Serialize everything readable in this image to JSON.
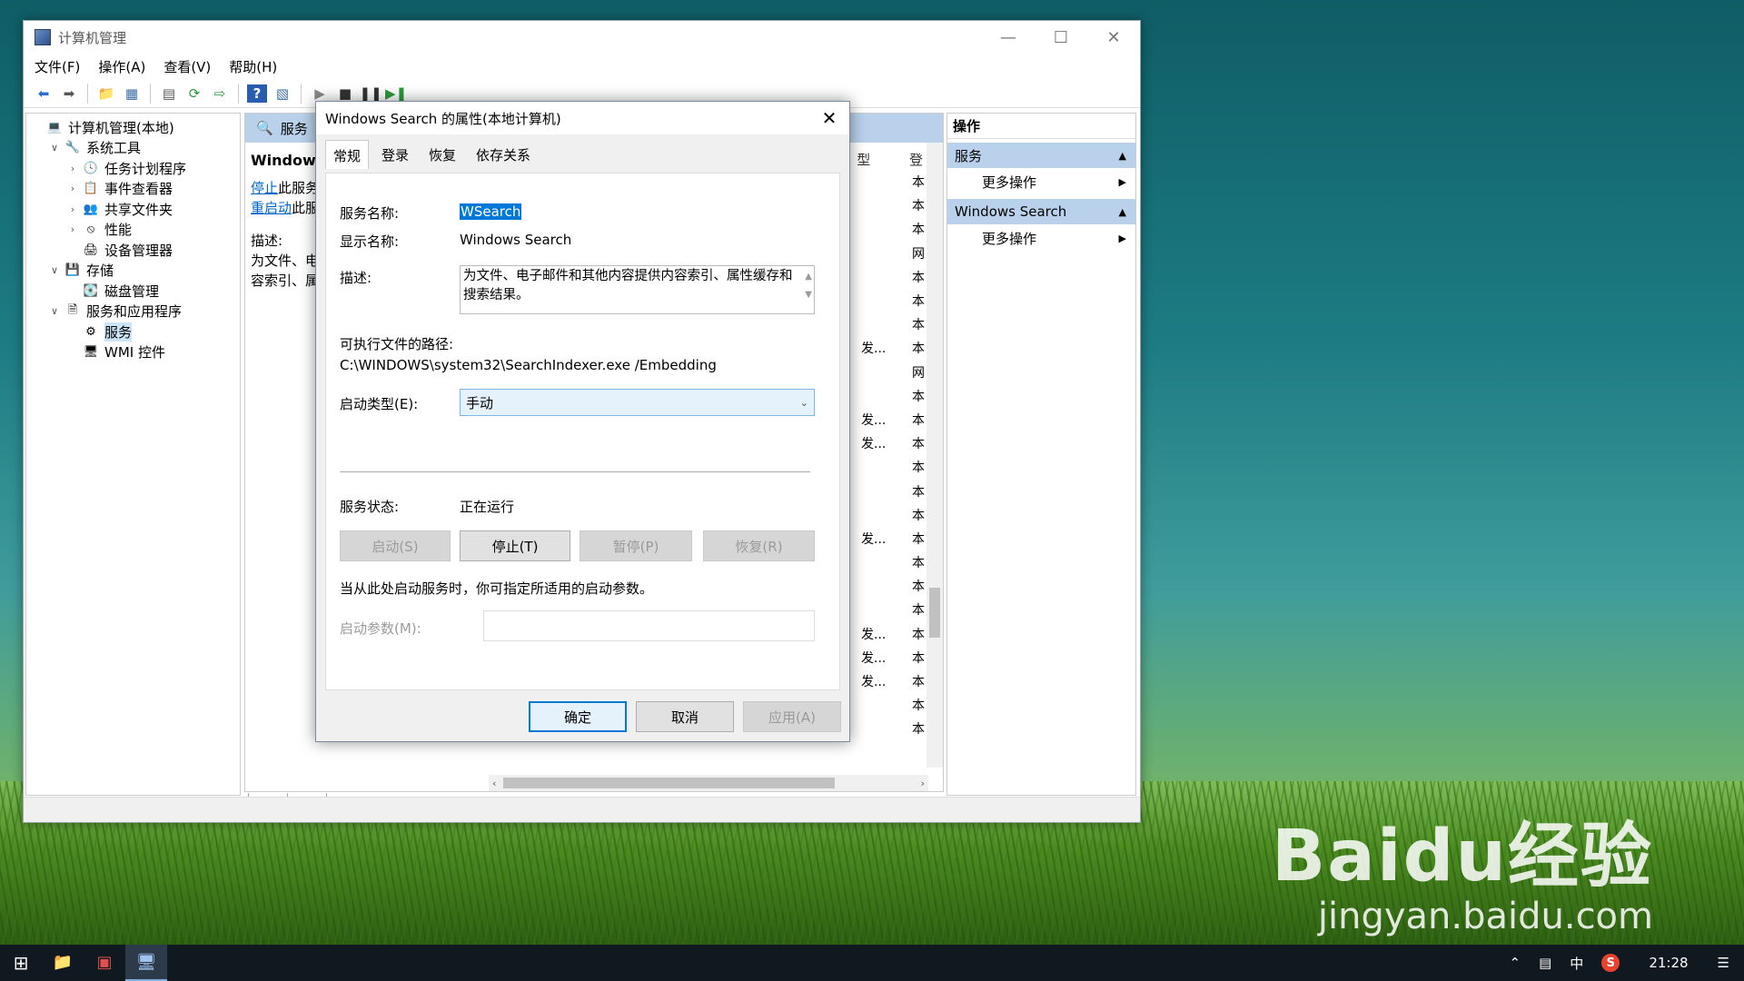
{
  "window": {
    "title": "计算机管理",
    "menu": [
      "文件(F)",
      "操作(A)",
      "查看(V)",
      "帮助(H)"
    ]
  },
  "tree": [
    {
      "label": "计算机管理(本地)",
      "icon": "computer-icon",
      "indent": 0,
      "expander": ""
    },
    {
      "label": "系统工具",
      "icon": "tools-icon",
      "indent": 1,
      "expander": "∨"
    },
    {
      "label": "任务计划程序",
      "icon": "clock-icon",
      "indent": 2,
      "expander": "›"
    },
    {
      "label": "事件查看器",
      "icon": "event-icon",
      "indent": 2,
      "expander": "›"
    },
    {
      "label": "共享文件夹",
      "icon": "share-icon",
      "indent": 2,
      "expander": "›"
    },
    {
      "label": "性能",
      "icon": "performance-icon",
      "indent": 2,
      "expander": "›"
    },
    {
      "label": "设备管理器",
      "icon": "device-icon",
      "indent": 2,
      "expander": ""
    },
    {
      "label": "存储",
      "icon": "storage-icon",
      "indent": 1,
      "expander": "∨"
    },
    {
      "label": "磁盘管理",
      "icon": "disk-icon",
      "indent": 2,
      "expander": ""
    },
    {
      "label": "服务和应用程序",
      "icon": "services-apps-icon",
      "indent": 1,
      "expander": "∨"
    },
    {
      "label": "服务",
      "icon": "services-icon",
      "indent": 2,
      "expander": "",
      "selected": true
    },
    {
      "label": "WMI 控件",
      "icon": "wmi-icon",
      "indent": 2,
      "expander": ""
    }
  ],
  "center": {
    "header": "服务",
    "service_name": "Windows",
    "stop_link": "停止",
    "stop_rest": "此服务",
    "restart_link": "重启动",
    "restart_rest": "此服",
    "desc_label": "描述:",
    "desc_line1": "为文件、电",
    "desc_line2": "容索引、属",
    "col_header_1": "型",
    "col_header_2": "登",
    "col_rows": [
      [
        "",
        "本"
      ],
      [
        "",
        "本"
      ],
      [
        "",
        "本"
      ],
      [
        "",
        "网"
      ],
      [
        "",
        "本"
      ],
      [
        "",
        "本"
      ],
      [
        "",
        "本"
      ],
      [
        "发...",
        "本"
      ],
      [
        "",
        "网"
      ],
      [
        "",
        "本"
      ],
      [
        "发...",
        "本"
      ],
      [
        "发...",
        "本"
      ],
      [
        "",
        "本"
      ],
      [
        "",
        "本"
      ],
      [
        "",
        "本"
      ],
      [
        "发...",
        "本"
      ],
      [
        "",
        "本"
      ],
      [
        "",
        "本"
      ],
      [
        "",
        "本"
      ],
      [
        "发...",
        "本"
      ],
      [
        "发...",
        "本"
      ],
      [
        "发...",
        "本"
      ],
      [
        "",
        "本"
      ],
      [
        "",
        "本"
      ]
    ],
    "bottom_tabs": [
      "扩展",
      "标准"
    ]
  },
  "actions": {
    "header": "操作",
    "groups": [
      {
        "title": "服务",
        "item": "更多操作"
      },
      {
        "title": "Windows Search",
        "item": "更多操作"
      }
    ]
  },
  "dialog": {
    "title": "Windows Search 的属性(本地计算机)",
    "tabs": [
      "常规",
      "登录",
      "恢复",
      "依存关系"
    ],
    "service_name_label": "服务名称:",
    "service_name_value": "WSearch",
    "display_name_label": "显示名称:",
    "display_name_value": "Windows Search",
    "description_label": "描述:",
    "description_value": "为文件、电子邮件和其他内容提供内容索引、属性缓存和搜索结果。",
    "path_label": "可执行文件的路径:",
    "path_value": "C:\\WINDOWS\\system32\\SearchIndexer.exe /Embedding",
    "startup_type_label": "启动类型(E):",
    "startup_type_value": "手动",
    "status_label": "服务状态:",
    "status_value": "正在运行",
    "btn_start": "启动(S)",
    "btn_stop": "停止(T)",
    "btn_pause": "暂停(P)",
    "btn_resume": "恢复(R)",
    "hint": "当从此处启动服务时，你可指定所适用的启动参数。",
    "param_label": "启动参数(M):",
    "btn_ok": "确定",
    "btn_cancel": "取消",
    "btn_apply": "应用(A)"
  },
  "taskbar": {
    "tray_ime": "中",
    "time": "21:28"
  },
  "watermark": {
    "main": "Baidu经验",
    "sub": "jingyan.baidu.com"
  }
}
